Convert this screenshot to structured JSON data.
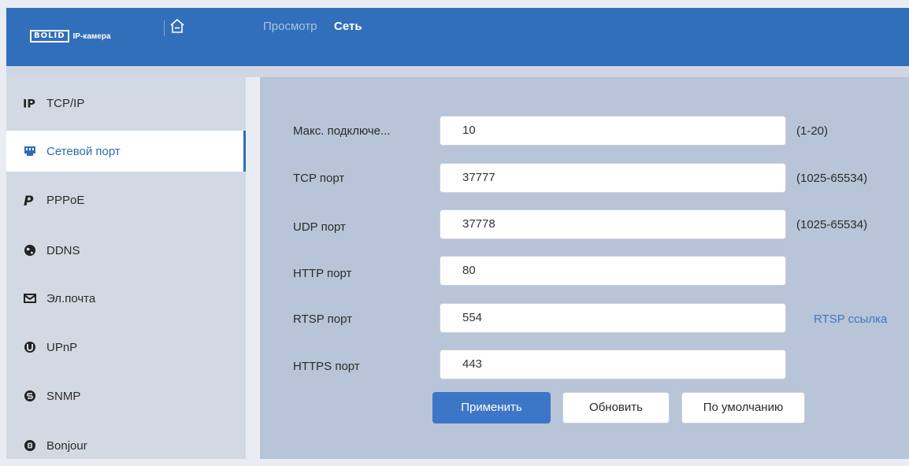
{
  "header": {
    "logo_brand": "BOLID",
    "logo_text": "IP-камера",
    "nav": [
      "Просмотр",
      "Сеть"
    ]
  },
  "sidebar": {
    "items": [
      {
        "label": "TCP/IP",
        "icon": "ip-icon",
        "active": false
      },
      {
        "label": "Сетевой порт",
        "icon": "network-port-icon",
        "active": true
      },
      {
        "label": "PPPoE",
        "icon": "pppoe-icon",
        "active": false
      },
      {
        "label": "DDNS",
        "icon": "globe-icon",
        "active": false
      },
      {
        "label": "Эл.почта",
        "icon": "mail-icon",
        "active": false
      },
      {
        "label": "UPnP",
        "icon": "upnp-icon",
        "active": false
      },
      {
        "label": "SNMP",
        "icon": "snmp-icon",
        "active": false
      },
      {
        "label": "Bonjour",
        "icon": "bonjour-icon",
        "active": false
      }
    ]
  },
  "form": {
    "rows": [
      {
        "label": "Макс. подключе...",
        "value": "10",
        "hint": "(1-20)"
      },
      {
        "label": "TCP порт",
        "value": "37777",
        "hint": "(1025-65534)"
      },
      {
        "label": "UDP порт",
        "value": "37778",
        "hint": "(1025-65534)"
      },
      {
        "label": "HTTP порт",
        "value": "80",
        "hint": ""
      },
      {
        "label": "RTSP порт",
        "value": "554",
        "hint": ""
      },
      {
        "label": "HTTPS порт",
        "value": "443",
        "hint": ""
      }
    ],
    "rtsp_link": "RTSP ссылка"
  },
  "buttons": {
    "apply": "Применить",
    "refresh": "Обновить",
    "default": "По умолчанию"
  },
  "colors": {
    "header": "#326fba",
    "accent": "#2f6cb5",
    "content_bg": "#b8c4d7",
    "sidebar_bg": "#d3d9e2"
  }
}
